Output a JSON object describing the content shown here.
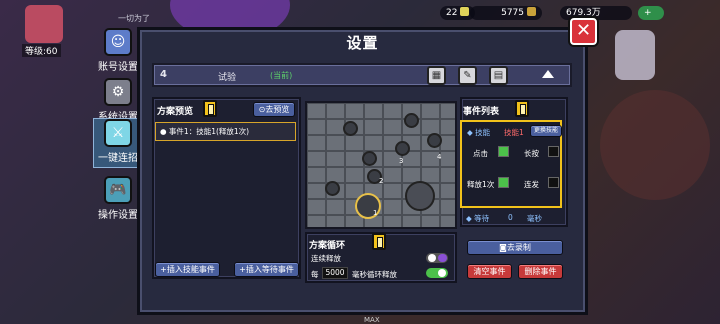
{
  "hud": {
    "player_label": "一切为了",
    "level_label": "等级:60",
    "resource_1": "22",
    "resource_2": "5775",
    "resource_3": "679.3万",
    "plus": "+"
  },
  "sidebar": {
    "items": [
      {
        "label": "账号设置",
        "icon": "account-icon"
      },
      {
        "label": "系统设置",
        "icon": "system-icon"
      },
      {
        "label": "一键连招",
        "icon": "combo-icon"
      },
      {
        "label": "操作设置",
        "icon": "gamepad-icon"
      }
    ]
  },
  "dialog": {
    "title": "设置",
    "close": "✕",
    "plan": {
      "number": "4",
      "name": "试验",
      "current": "(当前)"
    },
    "preview": {
      "title": "方案预览",
      "go_preview": "去预览",
      "event_item": "● 事件1：技能1(释放1次)"
    },
    "loop": {
      "title": "方案循环",
      "continuous": "连续释放",
      "every": "每",
      "ms": "5000",
      "ms_loop": "毫秒循环释放"
    },
    "buttons": {
      "insert_skill": "+插入技能事件",
      "insert_wait": "+插入等待事件"
    },
    "events": {
      "title": "事件列表",
      "skill_label": "◆ 技能",
      "skill_name": "技能1",
      "change_skill": "更换技能",
      "click": "点击",
      "long_press": "长按",
      "release_once": "释放1次",
      "rapid": "连发",
      "wait_label": "◆ 等待",
      "wait_value": "0",
      "wait_unit": "毫秒",
      "record": "去录制",
      "clear": "清空事件",
      "delete": "删除事件"
    },
    "map_numbers": [
      "3",
      "4",
      "2",
      "1"
    ]
  },
  "bottom": {
    "max": "MAX"
  }
}
